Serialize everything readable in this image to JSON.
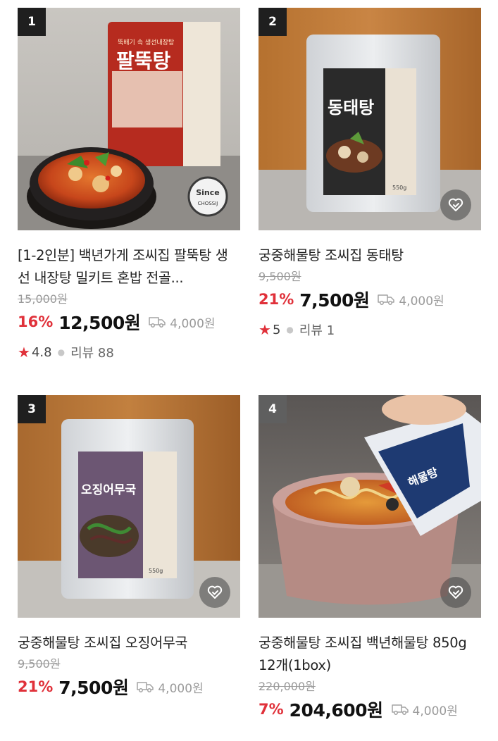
{
  "products": [
    {
      "rank": "1",
      "package_text": "팔뚝탕",
      "package_sub": "뚝배기 속 생선내장탕",
      "badge_text": "Since",
      "badge_sub": "CHOSSIJ",
      "title": "[1-2인분] 백년가게 조씨집 팔뚝탕 생선 내장탕 밀키트 혼밥 전골...",
      "original_price": "15,000원",
      "discount": "16%",
      "price": "12,500원",
      "shipping": "4,000원",
      "rating": "4.8",
      "review_label": "리뷰 88",
      "icon": "delivery-truck-icon"
    },
    {
      "rank": "2",
      "package_text": "동태탕",
      "package_sub": "550g",
      "title": "궁중해물탕 조씨집 동태탕",
      "original_price": "9,500원",
      "discount": "21%",
      "price": "7,500원",
      "shipping": "4,000원",
      "rating": "5",
      "review_label": "리뷰 1",
      "icon": "delivery-truck-icon"
    },
    {
      "rank": "3",
      "package_text": "오징어무국",
      "package_sub": "550g",
      "title": "궁중해물탕 조씨집 오징어무국",
      "original_price": "9,500원",
      "discount": "21%",
      "price": "7,500원",
      "shipping": "4,000원",
      "icon": "delivery-truck-icon"
    },
    {
      "rank": "4",
      "package_text": "해물탕",
      "title": "궁중해물탕 조씨집 백년해물탕 850g 12개(1box)",
      "original_price": "220,000원",
      "discount": "7%",
      "price": "204,600원",
      "shipping": "4,000원",
      "icon": "delivery-truck-icon"
    }
  ],
  "colors": {
    "discount": "#e0313a",
    "star": "#e0313a",
    "rank_badge": "#1f1f1f"
  }
}
